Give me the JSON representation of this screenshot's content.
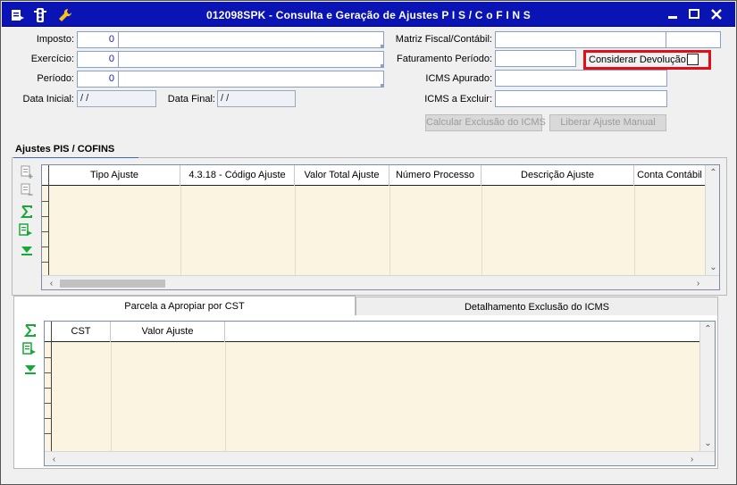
{
  "window": {
    "title": "012098SPK - Consulta e Geração de Ajustes P I S / C o F I N S",
    "controls": {
      "minimize": "—",
      "maximize": "▢",
      "close": "✕"
    }
  },
  "form": {
    "imposto": {
      "label": "Imposto:",
      "value": "0"
    },
    "exercicio": {
      "label": "Exercício:",
      "value": "0"
    },
    "periodo": {
      "label": "Período:",
      "value": "0"
    },
    "data_inicial": {
      "label": "Data Inicial:",
      "value": " / /"
    },
    "data_final": {
      "label": "Data Final:",
      "value": " / /"
    },
    "matriz_fiscal": {
      "label": "Matriz Fiscal/Contábil:",
      "value": ""
    },
    "faturamento_periodo": {
      "label": "Faturamento Período:",
      "value": ""
    },
    "considerar_devolucao": {
      "label": "Considerar Devolução:",
      "checked": false
    },
    "icms_apurado": {
      "label": "ICMS Apurado:",
      "value": ""
    },
    "icms_excluir": {
      "label": "ICMS a Excluir:",
      "value": ""
    },
    "calcular_btn": "Calcular Exclusão do ICMS",
    "liberar_btn": "Liberar Ajuste Manual"
  },
  "ajustes": {
    "section_title": "Ajustes PIS / COFINS",
    "columns": [
      "Tipo Ajuste",
      "4.3.18 - Código Ajuste",
      "Valor Total Ajuste",
      "Número Processo",
      "Descrição Ajuste",
      "Conta Contábil"
    ],
    "rows": []
  },
  "lower": {
    "tabs": [
      "Parcela a Apropiar por CST",
      "Detalhamento Exclusão do ICMS"
    ],
    "active_tab": 0,
    "columns": [
      "CST",
      "Valor Ajuste"
    ],
    "rows": []
  },
  "icons": {
    "title_app": "window-menu-icon",
    "title_semaphore": "traffic-light-icon",
    "title_tool": "wrench-icon",
    "add_row": "add-row-icon",
    "remove_row": "remove-row-icon",
    "sum": "sigma-icon",
    "export": "export-icon",
    "expand": "download-arrow-icon"
  },
  "colors": {
    "titlebar": "#0a14b4",
    "highlight_border": "#e30c18",
    "grid_bg": "#fbf4e0",
    "green_icon": "#18a838"
  }
}
